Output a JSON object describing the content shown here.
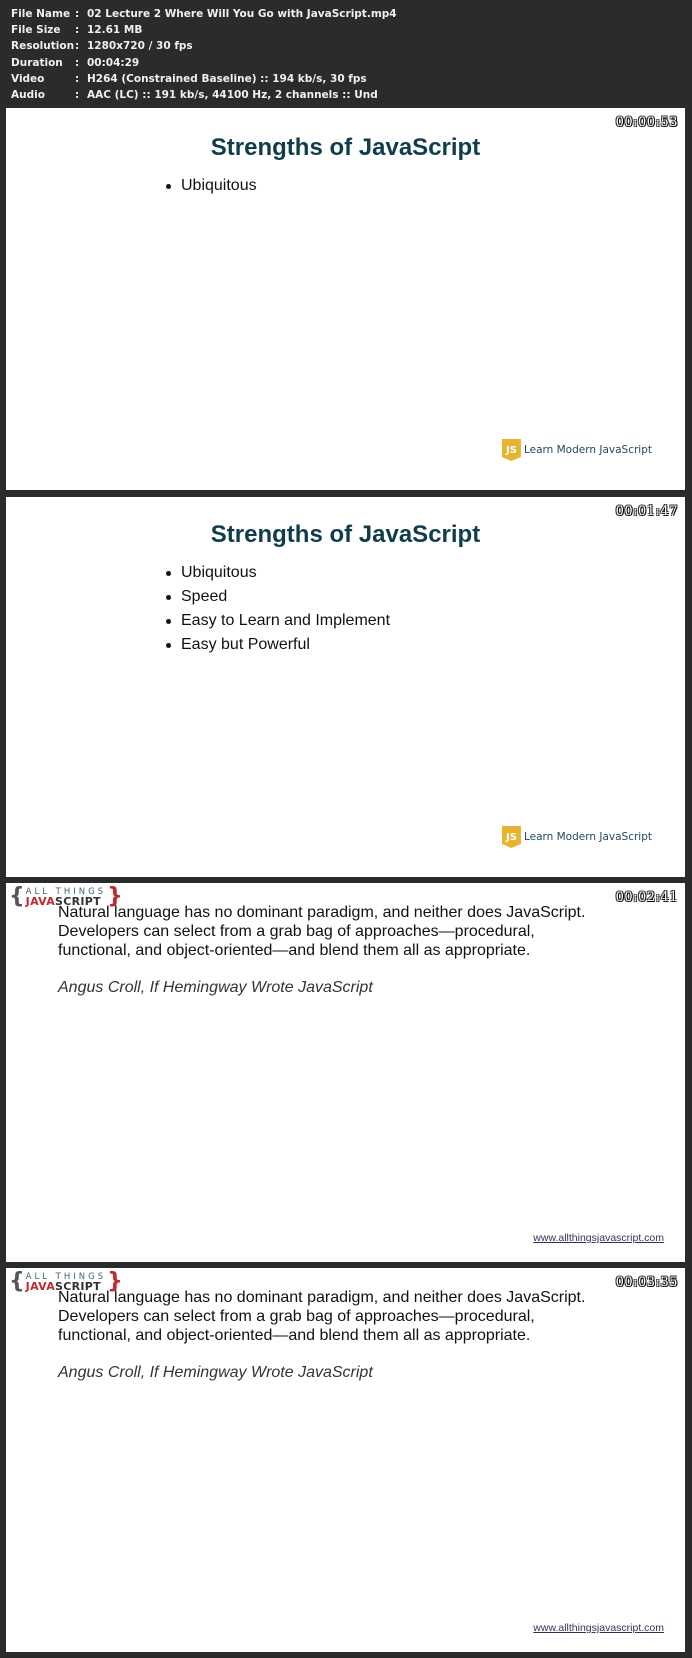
{
  "file_info": [
    {
      "key": "File Name",
      "value": "02 Lecture 2 Where Will You Go with JavaScript.mp4"
    },
    {
      "key": "File Size",
      "value": "12.61 MB"
    },
    {
      "key": "Resolution",
      "value": "1280x720 / 30 fps"
    },
    {
      "key": "Duration",
      "value": "00:04:29"
    },
    {
      "key": "Video",
      "value": "H264 (Constrained Baseline) :: 194 kb/s, 30 fps"
    },
    {
      "key": "Audio",
      "value": "AAC (LC) :: 191 kb/s, 44100 Hz, 2 channels :: Und"
    }
  ],
  "separator": ":",
  "frames": [
    {
      "timestamp": "00:00:53",
      "title": "Strengths of JavaScript",
      "bullets": [
        "Ubiquitous"
      ],
      "logo": {
        "icon": "js-shield-icon",
        "glyph": "JS",
        "text": "Learn Modern JavaScript",
        "color": "#e7b432"
      }
    },
    {
      "timestamp": "00:01:47",
      "title": "Strengths of JavaScript",
      "bullets": [
        "Ubiquitous",
        "Speed",
        "Easy to Learn and Implement",
        "Easy but Powerful"
      ],
      "logo": {
        "icon": "js-shield-icon",
        "glyph": "JS",
        "text": "Learn Modern JavaScript",
        "color": "#e7b432"
      }
    },
    {
      "timestamp": "00:02:41",
      "brand": {
        "brace_left": "{",
        "top": "ALL THINGS",
        "java": "JAVA",
        "script": "SCRIPT",
        "brace_right": "}"
      },
      "quote_lines": [
        "Natural language has no dominant paradigm, and neither does JavaScript.",
        "Developers can select from a grab bag of approaches—procedural,",
        "functional, and object-oriented—and blend them all as appropriate."
      ],
      "citation": "Angus Croll, If Hemingway Wrote JavaScript",
      "link": "www.allthingsjavascript.com"
    },
    {
      "timestamp": "00:03:35",
      "brand": {
        "brace_left": "{",
        "top": "ALL THINGS",
        "java": "JAVA",
        "script": "SCRIPT",
        "brace_right": "}"
      },
      "quote_lines": [
        "Natural language has no dominant paradigm, and neither does JavaScript.",
        "Developers can select from a grab bag of approaches—procedural,",
        "functional, and object-oriented—and blend them all as appropriate."
      ],
      "citation": "Angus Croll, If Hemingway Wrote JavaScript",
      "link": "www.allthingsjavascript.com"
    }
  ]
}
